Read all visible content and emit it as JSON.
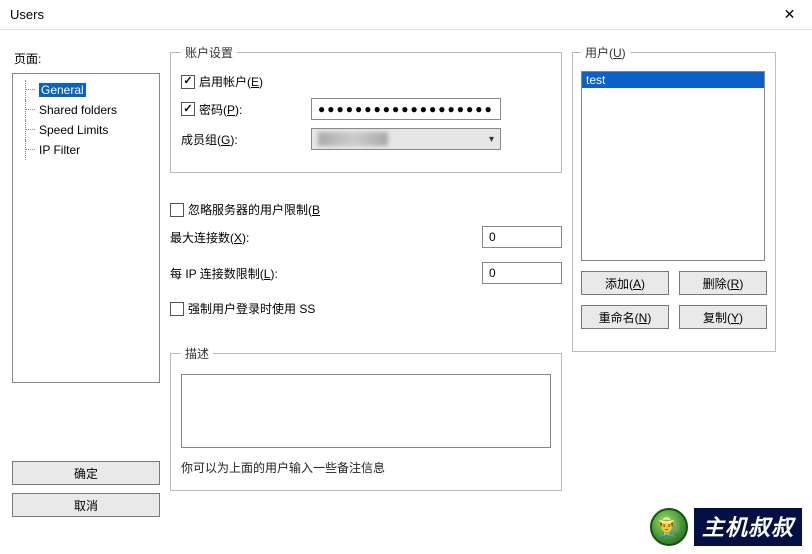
{
  "titlebar": {
    "title": "Users"
  },
  "left": {
    "pages_label": "页面:",
    "ok_label": "确定",
    "cancel_label": "取消",
    "items": [
      {
        "label": "General",
        "selected": true
      },
      {
        "label": "Shared folders",
        "selected": false
      },
      {
        "label": "Speed Limits",
        "selected": false
      },
      {
        "label": "IP Filter",
        "selected": false
      }
    ]
  },
  "account": {
    "legend": "账户设置",
    "enable_label_pre": "启用帐户(",
    "enable_hotkey": "E",
    "enable_label_post": ")",
    "password_label_pre": "密码(",
    "password_hotkey": "P",
    "password_label_post": "):",
    "password_value": "●●●●●●●●●●●●●●●●●●●",
    "group_label_pre": "成员组(",
    "group_hotkey": "G",
    "group_label_post": "):",
    "group_value": ""
  },
  "limits": {
    "ignore_label_pre": "忽略服务器的用户限制(",
    "ignore_hotkey": "B",
    "max_conn_label_pre": "最大连接数(",
    "max_conn_hotkey": "X",
    "max_conn_label_post": "):",
    "max_conn_value": "0",
    "per_ip_label_pre": "每 IP 连接数限制(",
    "per_ip_hotkey": "L",
    "per_ip_label_post": "):",
    "per_ip_value": "0",
    "force_ssl_label": "强制用户登录时使用 SS"
  },
  "desc": {
    "legend": "描述",
    "value": "",
    "help": "你可以为上面的用户输入一些备注信息"
  },
  "users": {
    "legend_pre": "用户(",
    "legend_hotkey": "U",
    "legend_post": ")",
    "items": [
      {
        "name": "test",
        "selected": true
      }
    ],
    "add_pre": "添加(",
    "add_hotkey": "A",
    "add_post": ")",
    "remove_pre": "删除(",
    "remove_hotkey": "R",
    "remove_post": ")",
    "rename_pre": "重命名(",
    "rename_hotkey": "N",
    "rename_post": ")",
    "copy_pre": "复制(",
    "copy_hotkey": "Y",
    "copy_post": ")"
  },
  "watermark": {
    "text": "主机叔叔"
  }
}
